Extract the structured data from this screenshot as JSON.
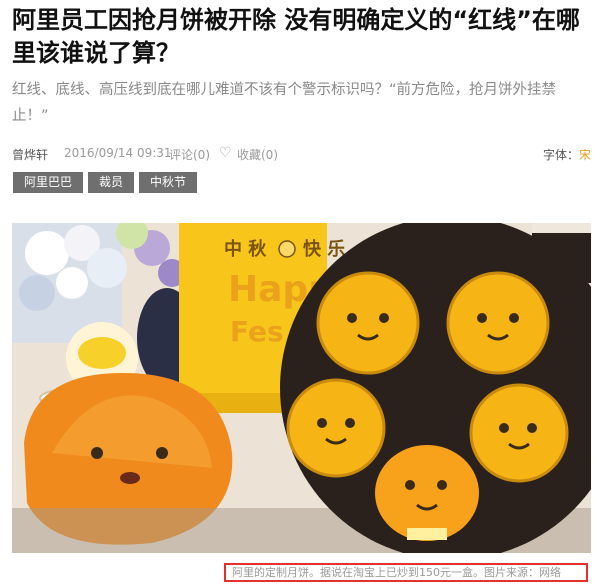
{
  "article": {
    "title": "阿里员工因抢月饼被开除 没有明确定义的“红线”在哪里该谁说了算？",
    "summary": "红线、底线、高压线到底在哪儿难道不该有个警示标识吗？“前方危险，抢月饼外挂禁止！”",
    "meta": {
      "author": "曾烨轩",
      "datetime": "2016/09/14 09:31",
      "comments": "评论(0)",
      "favorites": "收藏(0)",
      "font_size_label": "字体：",
      "font_size_value": "宋"
    },
    "tags": [
      "阿里巴巴",
      "裁员",
      "中秋节"
    ],
    "image": {
      "box_text_1": "中 秋",
      "box_text_2": "快 乐",
      "box_text_3": "Happ",
      "box_text_4": "Fes"
    },
    "caption": "阿里的定制月饼。据说在淘宝上已炒到150元一盒。图片来源：网络"
  },
  "colors": {
    "tag_bg": "#6f6f6f",
    "caption_border": "#e53030",
    "mooncake_yellow": "#f7b515"
  }
}
